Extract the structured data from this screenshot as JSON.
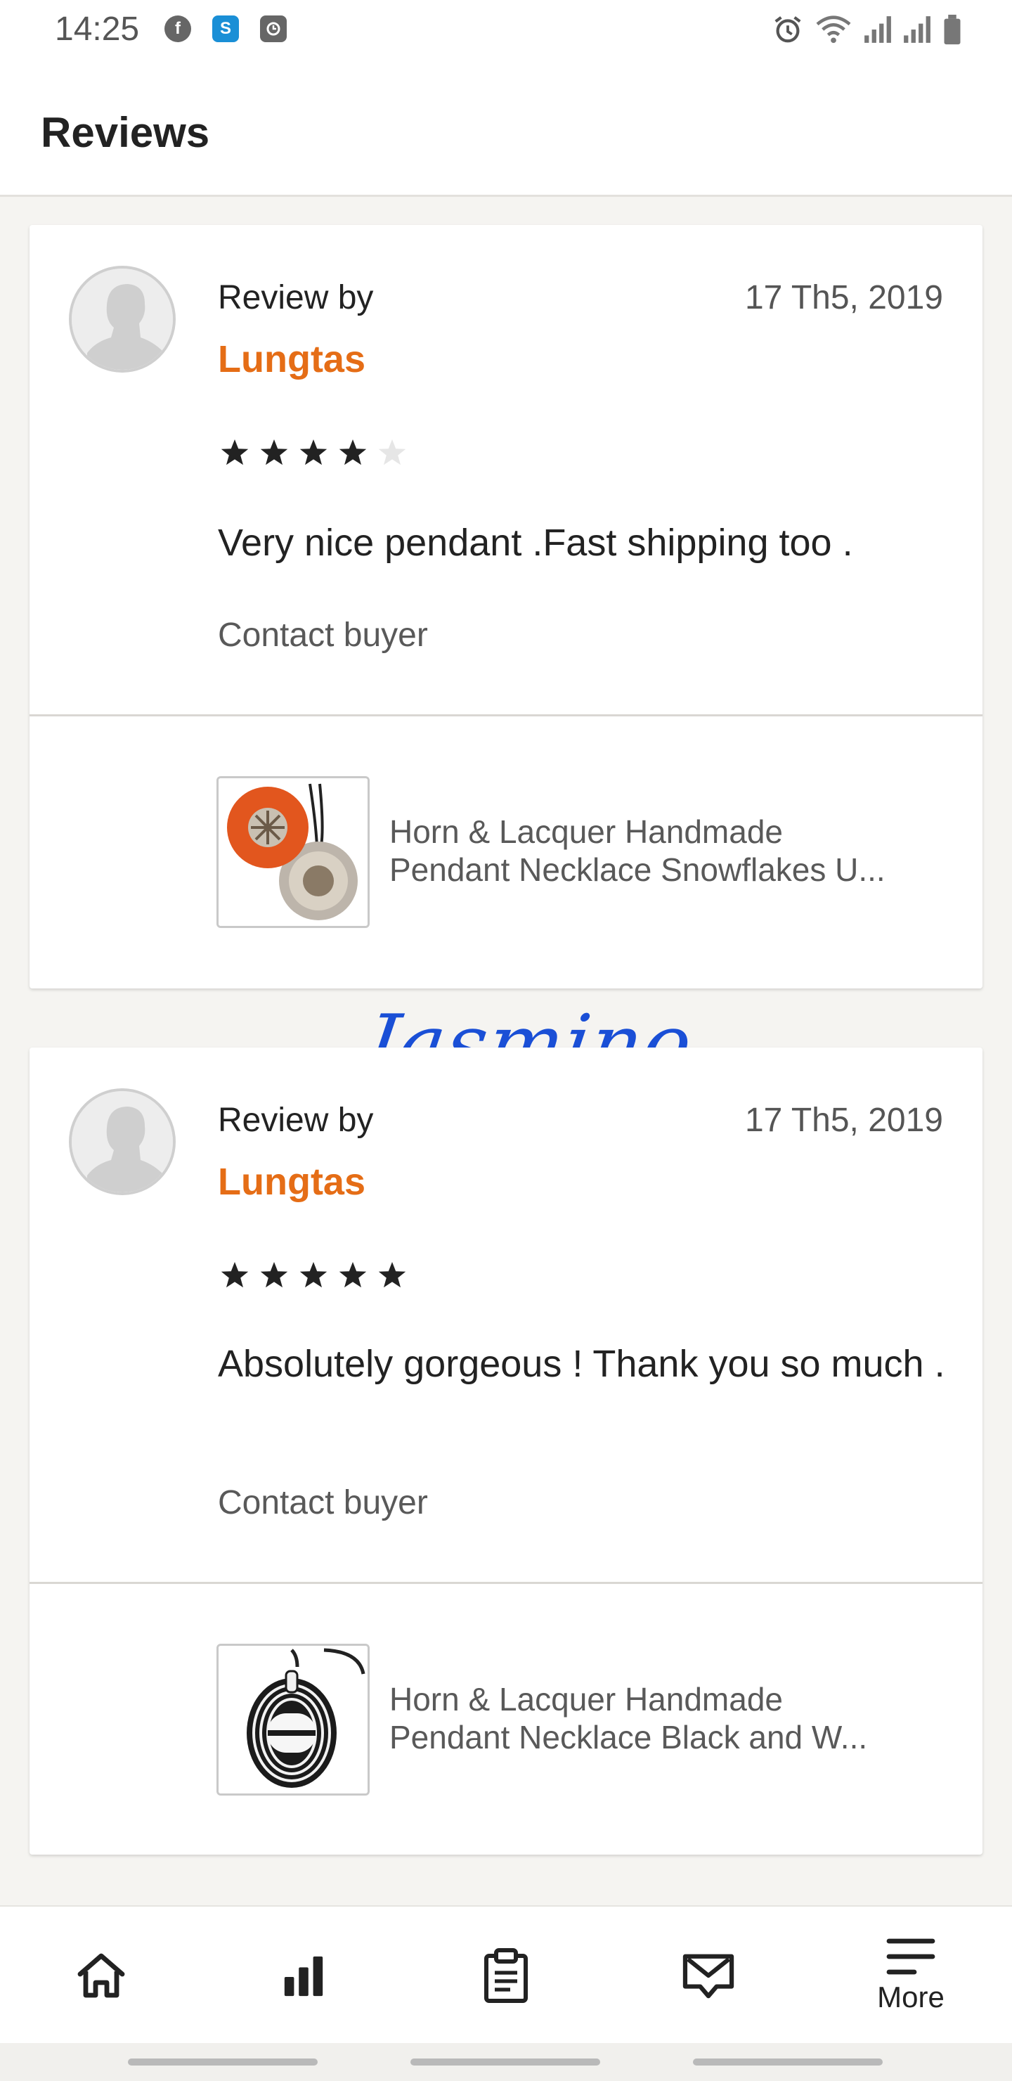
{
  "status_bar": {
    "time": "14:25",
    "app_icons": [
      "facebook-icon",
      "skype-icon",
      "clock-app-icon"
    ],
    "system_icons": [
      "alarm-icon",
      "wifi-icon",
      "signal-icon",
      "signal-icon",
      "battery-icon"
    ]
  },
  "header": {
    "title": "Reviews"
  },
  "reviews": [
    {
      "review_by_label": "Review by",
      "reviewer": "Lungtas",
      "date": "17 Th5, 2019",
      "rating": 4,
      "rating_max": 5,
      "text": "Very nice pendant .Fast shipping too .",
      "contact_label": "Contact buyer",
      "listing": {
        "title_line1": "Horn & Lacquer Handmade",
        "title_line2": "Pendant Necklace Snowflakes U..."
      }
    },
    {
      "review_by_label": "Review by",
      "reviewer": "Lungtas",
      "date": "17 Th5, 2019",
      "rating": 5,
      "rating_max": 5,
      "text": "Absolutely gorgeous ! Thank you so much .",
      "contact_label": "Contact buyer",
      "listing": {
        "title_line1": "Horn & Lacquer Handmade",
        "title_line2": "Pendant Necklace Black and W..."
      }
    }
  ],
  "watermark": "Jasmino",
  "bottom_nav": {
    "items": [
      {
        "icon": "home-icon",
        "label": ""
      },
      {
        "icon": "stats-icon",
        "label": ""
      },
      {
        "icon": "orders-clipboard-icon",
        "label": ""
      },
      {
        "icon": "messages-icon",
        "label": ""
      },
      {
        "icon": "menu-icon",
        "label": "More"
      }
    ]
  },
  "colors": {
    "accent": "#e56d16",
    "background": "#f5f4f1",
    "star_filled": "#222222",
    "star_empty": "#e6e6e6",
    "watermark": "#1a4fd6"
  }
}
